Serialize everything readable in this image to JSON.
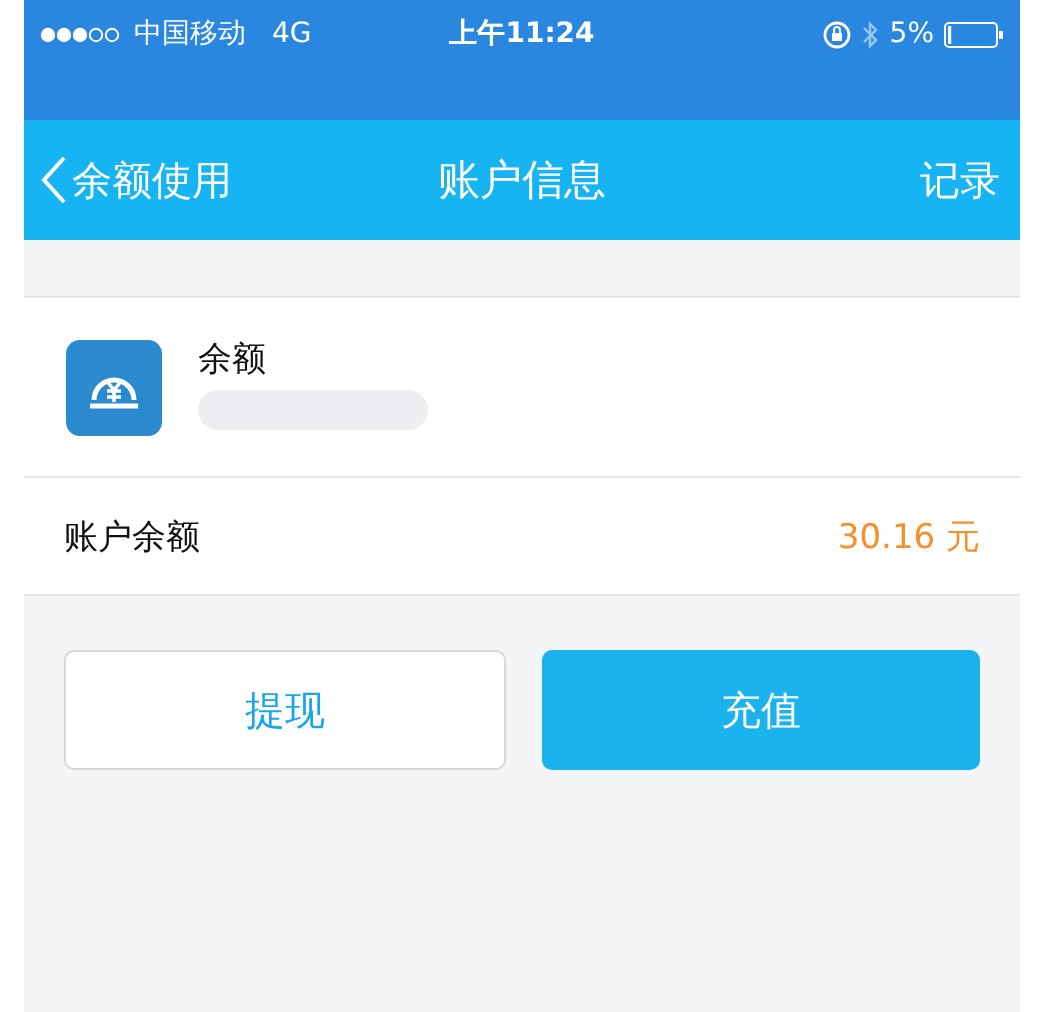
{
  "status_bar": {
    "carrier": "中国移动",
    "network": "4G",
    "time": "上午11:24",
    "battery": "5%"
  },
  "nav_bar": {
    "back_label": "余额使用",
    "title": "账户信息",
    "action": "记录"
  },
  "account": {
    "name": "余额"
  },
  "balance_row": {
    "label": "账户余额",
    "value": "30.16 元"
  },
  "buttons": [
    {
      "label": "提现",
      "kind": "secondary"
    },
    {
      "label": "充值",
      "kind": "primary"
    }
  ]
}
